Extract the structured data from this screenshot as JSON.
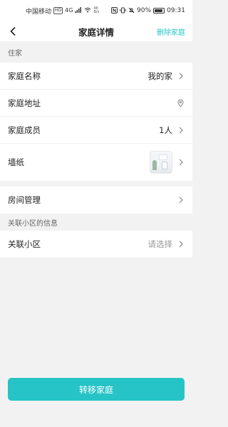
{
  "status_bar": {
    "carrier": "中国移动",
    "hd_badge": "HD",
    "network": "4G",
    "speed_value": "46",
    "speed_unit": "B/s",
    "battery_text": "90%",
    "battery_level": 0.9,
    "time": "09:31"
  },
  "header": {
    "title": "家庭详情",
    "back_icon": "chevron-left-icon",
    "action_label": "删除家庭"
  },
  "sections": {
    "home_label": "住家",
    "community_label": "关联小区的信息"
  },
  "home_rows": {
    "name_label": "家庭名称",
    "name_value": "我的家",
    "address_label": "家庭地址",
    "members_label": "家庭成员",
    "members_value": "1人",
    "wallpaper_label": "墙纸"
  },
  "room_row": {
    "label": "房间管理"
  },
  "community_row": {
    "label": "关联小区",
    "value": "请选择"
  },
  "footer": {
    "transfer_label": "转移家庭"
  },
  "colors": {
    "accent": "#26c4c6",
    "background": "#f2f2f2"
  }
}
